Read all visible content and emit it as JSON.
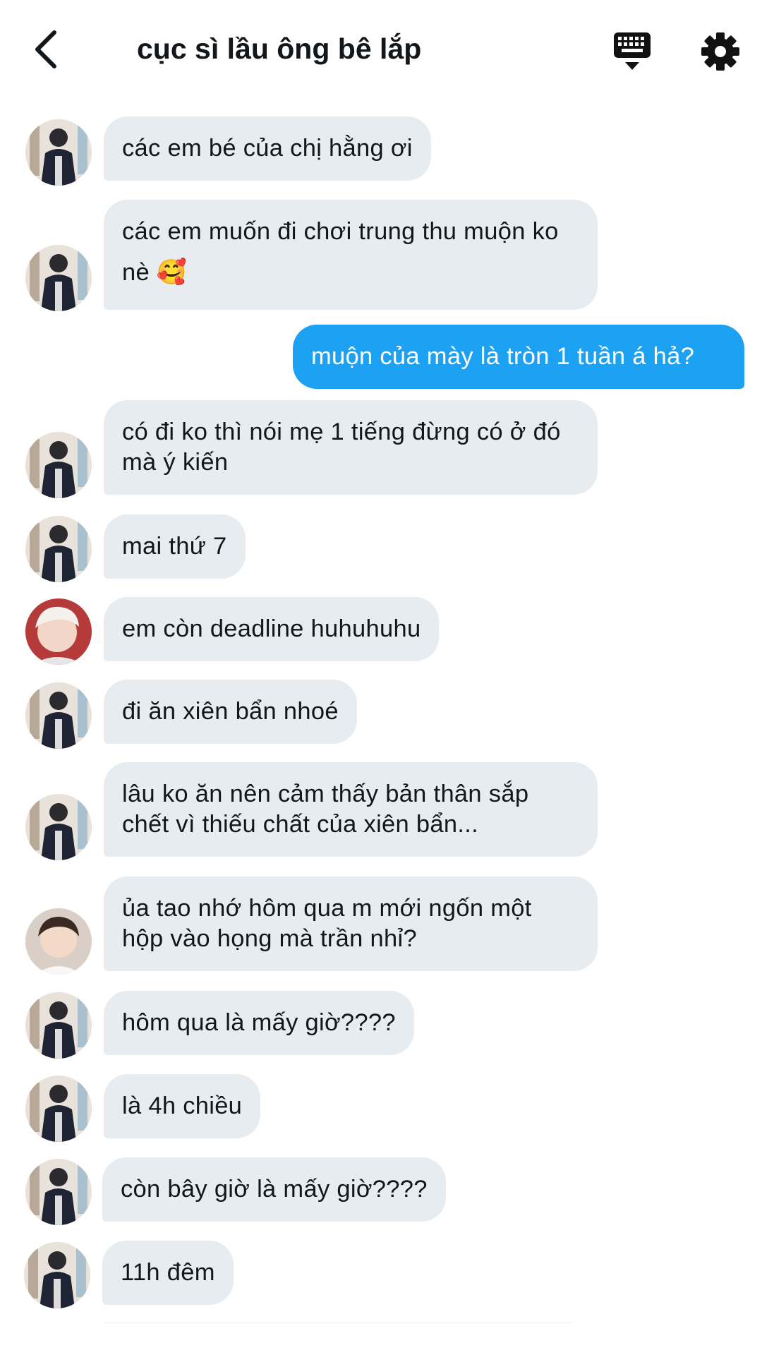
{
  "header": {
    "title": "cục sì lầu ông bê lắp",
    "back_icon": "chevron-left-icon",
    "keyboard_icon": "keyboard-icon",
    "settings_icon": "gear-icon"
  },
  "colors": {
    "incoming_bubble": "#e6ecf0",
    "outgoing_bubble": "#1da1f2",
    "text": "#14171a"
  },
  "messages": [
    {
      "sender": "other",
      "text": "các em bé của chị hằng ơi"
    },
    {
      "sender": "other",
      "text": "các em muốn đi chơi trung thu muộn ko nè 🥰"
    },
    {
      "sender": "self",
      "text": "muộn của mày là tròn 1 tuần á hả?"
    },
    {
      "sender": "other",
      "text": "có đi ko thì nói mẹ 1 tiếng đừng có ở đó mà ý kiến"
    },
    {
      "sender": "other",
      "text": "mai thứ 7"
    },
    {
      "sender": "other",
      "text": "em còn deadline huhuhuhu"
    },
    {
      "sender": "other",
      "text": "đi ăn xiên bẩn nhoé"
    },
    {
      "sender": "other",
      "text": "lâu ko ăn nên cảm thấy bản thân sắp chết vì thiếu chất của xiên bẩn..."
    },
    {
      "sender": "other",
      "text": "ủa tao nhớ hôm qua m mới ngốn một hộp vào họng mà trần nhỉ?"
    },
    {
      "sender": "other",
      "text": "hôm qua là mấy giờ????"
    },
    {
      "sender": "other",
      "text": "là 4h chiều"
    },
    {
      "sender": "other",
      "text": "còn bây giờ là mấy giờ????"
    },
    {
      "sender": "other",
      "text": "11h đêm"
    }
  ]
}
